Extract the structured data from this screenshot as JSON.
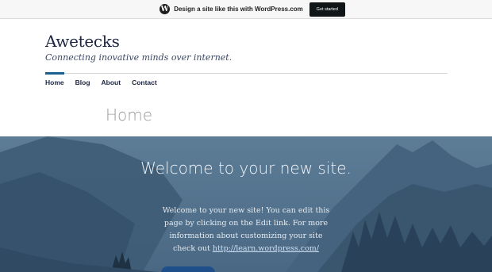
{
  "promo_bar": {
    "logo_icon": "wordpress-logo-icon",
    "text": "Design a site like this with WordPress.com",
    "button_label": "Get started"
  },
  "header": {
    "site_title": "Awetecks",
    "tagline": "Connecting inovative minds over internet."
  },
  "nav": {
    "items": [
      {
        "label": "Home",
        "active": true
      },
      {
        "label": "Blog",
        "active": false
      },
      {
        "label": "About",
        "active": false
      },
      {
        "label": "Contact",
        "active": false
      }
    ]
  },
  "page": {
    "title": "Home"
  },
  "hero": {
    "heading": "Welcome to your new site.",
    "body_prefix": "Welcome to your new site! You can edit this page by clicking on the Edit link. For more information about customizing your site check out",
    "link_text": "http://learn.wordpress.com/"
  },
  "colors": {
    "accent": "#1c5f91",
    "title": "#1c2543",
    "hero_overlay": "#4a6a86",
    "button": "#1e4f8a"
  }
}
